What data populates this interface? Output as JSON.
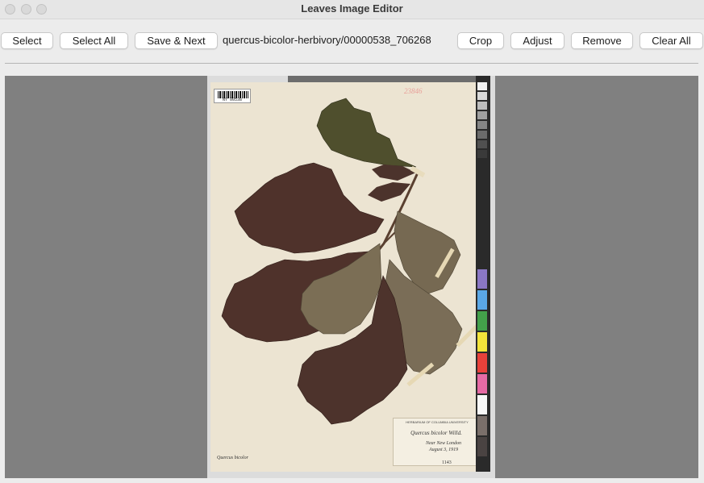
{
  "window": {
    "title": "Leaves Image Editor",
    "traffic_lights": [
      "close",
      "minimize",
      "zoom"
    ]
  },
  "toolbar": {
    "select_label": "Select",
    "select_all_label": "Select All",
    "save_next_label": "Save & Next",
    "path_text": "quercus-bicolor-herbivory/00000538_706268",
    "crop_label": "Crop",
    "adjust_label": "Adjust",
    "remove_label": "Remove",
    "clear_all_label": "Clear All"
  },
  "specimen": {
    "barcode_number": "NY 00538",
    "scan_number": "23846",
    "label_header": "HERBARIUM OF COLUMBIA UNIVERSITY",
    "scientific_name": "Quercus bicolor Willd.",
    "locality": "Near New London",
    "date": "August 3, 1919",
    "note_1": "Quercus bicolor",
    "note_2": "",
    "note_3": "1143"
  },
  "colors": {
    "window_bg": "#ececec",
    "canvas_bg": "#808080",
    "sheet_bg": "#ece4d2",
    "leaf_dark": "#4f322b",
    "leaf_light": "#7b6e55"
  }
}
